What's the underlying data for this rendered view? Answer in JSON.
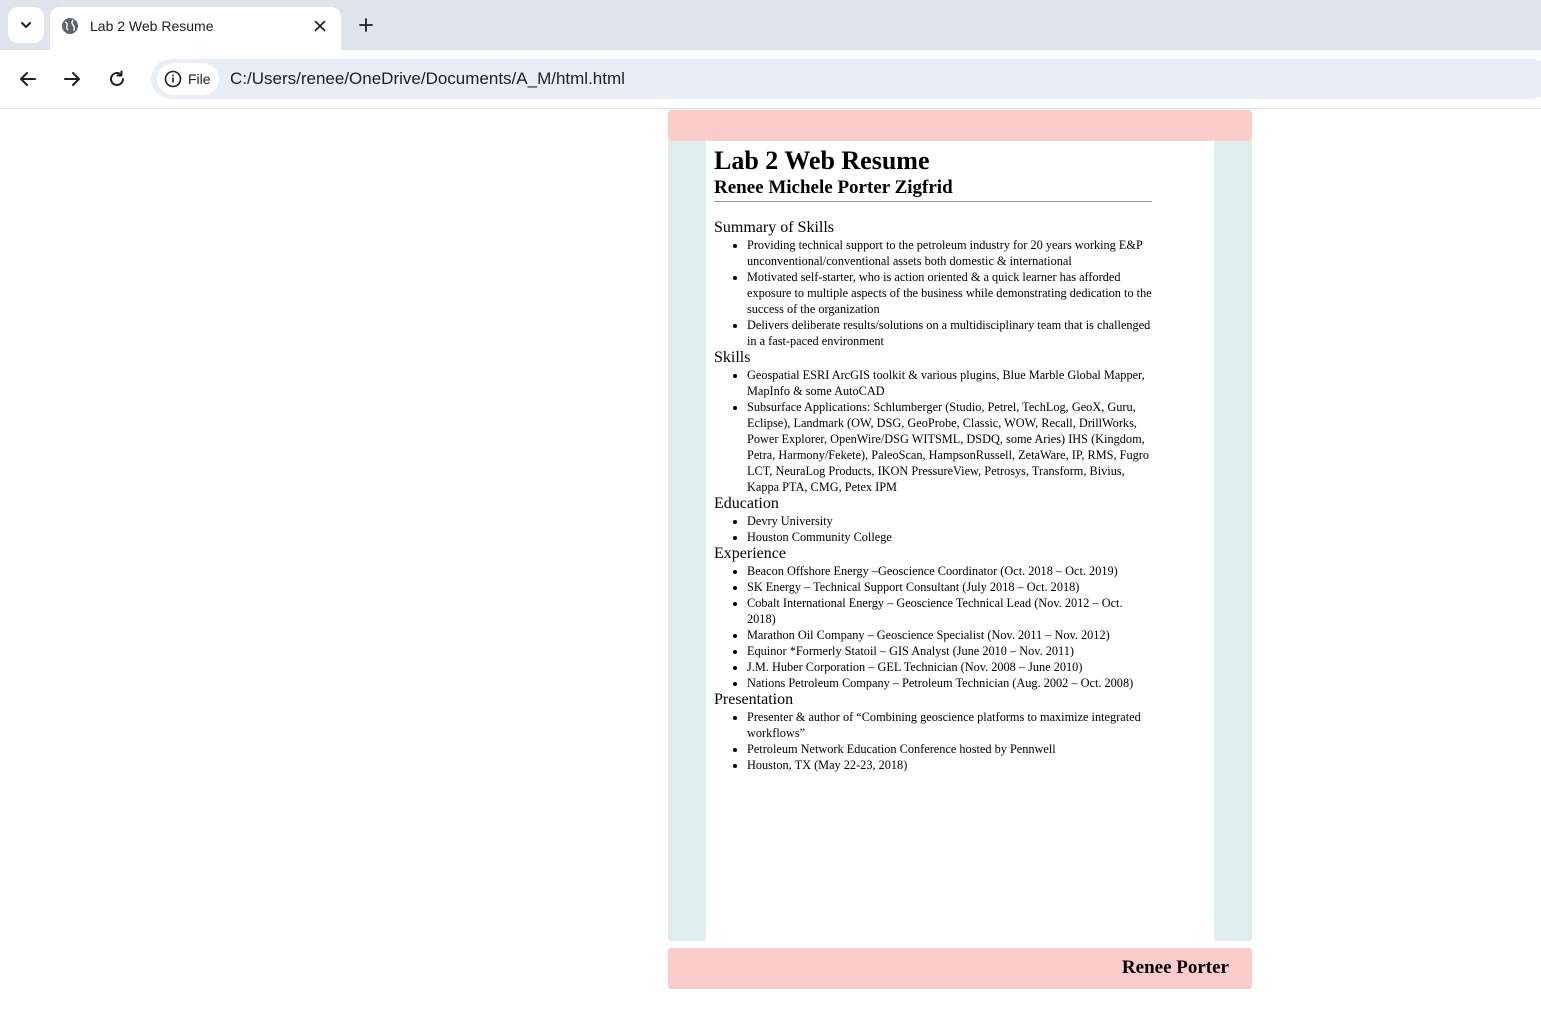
{
  "browser": {
    "tab_title": "Lab 2 Web Resume",
    "site_chip_label": "File",
    "url": "C:/Users/renee/OneDrive/Documents/A_M/html.html"
  },
  "resume": {
    "title": "Lab 2 Web Resume",
    "name": "Renee Michele Porter Zigfrid",
    "sections": [
      {
        "heading": "Summary of Skills",
        "items": [
          "Providing technical support to the petroleum industry for 20 years working E&P unconventional/conventional assets both domestic & international",
          "Motivated self-starter, who is action oriented & a quick learner has afforded exposure to multiple aspects of the business while demonstrating dedication to the success of the organization",
          "Delivers deliberate results/solutions on a multidisciplinary team that is challenged in a fast-paced environment"
        ]
      },
      {
        "heading": "Skills",
        "items": [
          "Geospatial ESRI ArcGIS toolkit & various plugins, Blue Marble Global Mapper, MapInfo & some AutoCAD",
          "Subsurface Applications: Schlumberger (Studio, Petrel, TechLog, GeoX, Guru, Eclipse), Landmark (OW, DSG, GeoProbe, Classic, WOW, Recall, DrillWorks, Power Explorer, OpenWire/DSG WITSML, DSDQ, some Aries) IHS (Kingdom, Petra, Harmony/Fekete), PaleoScan, HampsonRussell, ZetaWare, IP, RMS, Fugro LCT, NeuraLog Products, IKON PressureView, Petrosys, Transform, Bivius, Kappa PTA, CMG, Petex IPM"
        ]
      },
      {
        "heading": "Education",
        "items": [
          "Devry University",
          "Houston Community College"
        ]
      },
      {
        "heading": "Experience",
        "items": [
          "Beacon Offshore Energy –Geoscience Coordinator (Oct. 2018 – Oct. 2019)",
          "SK Energy – Technical Support Consultant (July 2018 – Oct. 2018)",
          "Cobalt International Energy – Geoscience Technical Lead (Nov. 2012 – Oct. 2018)",
          "Marathon Oil Company – Geoscience Specialist (Nov. 2011 – Nov. 2012)",
          "Equinor *Formerly Statoil – GIS Analyst (June 2010 – Nov. 2011)",
          "J.M. Huber Corporation – GEL Technician (Nov. 2008 – June 2010)",
          "Nations Petroleum Company – Petroleum Technician (Aug. 2002 – Oct. 2008)"
        ]
      },
      {
        "heading": "Presentation",
        "items": [
          "Presenter & author of “Combining geoscience platforms to maximize integrated workflows”",
          "Petroleum Network Education Conference hosted by Pennwell",
          "Houston, TX (May 22-23, 2018)"
        ]
      }
    ],
    "footer_name": "Renee Porter"
  },
  "colors": {
    "header_footer_band": "#fccccb",
    "side_columns": "#dfedec",
    "tabstrip": "#dfe3eb",
    "omnibox": "#e9edf6"
  }
}
